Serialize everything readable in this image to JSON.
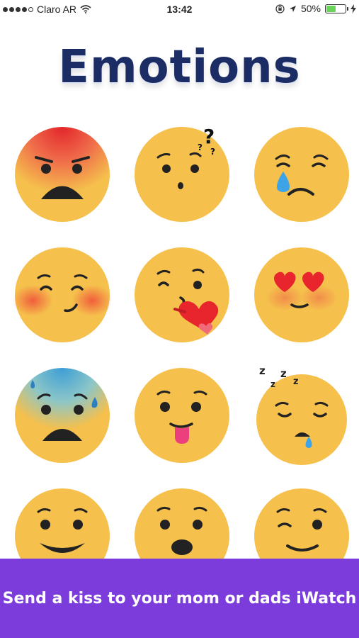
{
  "status_bar": {
    "carrier": "Claro AR",
    "time": "13:42",
    "battery": "50%",
    "battery_level": 0.5,
    "icons": [
      "signal-dots-icon",
      "wifi-icon",
      "rotation-lock-icon",
      "location-arrow-icon",
      "battery-icon",
      "charging-bolt-icon"
    ]
  },
  "title": "Emotions",
  "emojis": [
    {
      "mood": "angry",
      "icon": "angry-face-icon"
    },
    {
      "mood": "confused",
      "icon": "confused-face-icon"
    },
    {
      "mood": "crying",
      "icon": "crying-face-icon"
    },
    {
      "mood": "blushing",
      "icon": "blushing-face-icon"
    },
    {
      "mood": "kiss",
      "icon": "kiss-heart-face-icon"
    },
    {
      "mood": "love",
      "icon": "heart-eyes-face-icon"
    },
    {
      "mood": "scared",
      "icon": "cold-sweat-face-icon"
    },
    {
      "mood": "tongue",
      "icon": "tongue-out-face-icon"
    },
    {
      "mood": "sleepy",
      "icon": "sleeping-face-icon"
    },
    {
      "mood": "laughing",
      "icon": "laughing-face-icon"
    },
    {
      "mood": "surprised",
      "icon": "surprised-face-icon"
    },
    {
      "mood": "wink",
      "icon": "winking-face-icon"
    }
  ],
  "banner": {
    "text": "Send a kiss to your mom or dads iWatch"
  },
  "colors": {
    "face": "#f5c04c",
    "banner": "#7b3cdb",
    "title": "#1b2d64",
    "heart": "#e8242c",
    "tear": "#3da4e8"
  }
}
